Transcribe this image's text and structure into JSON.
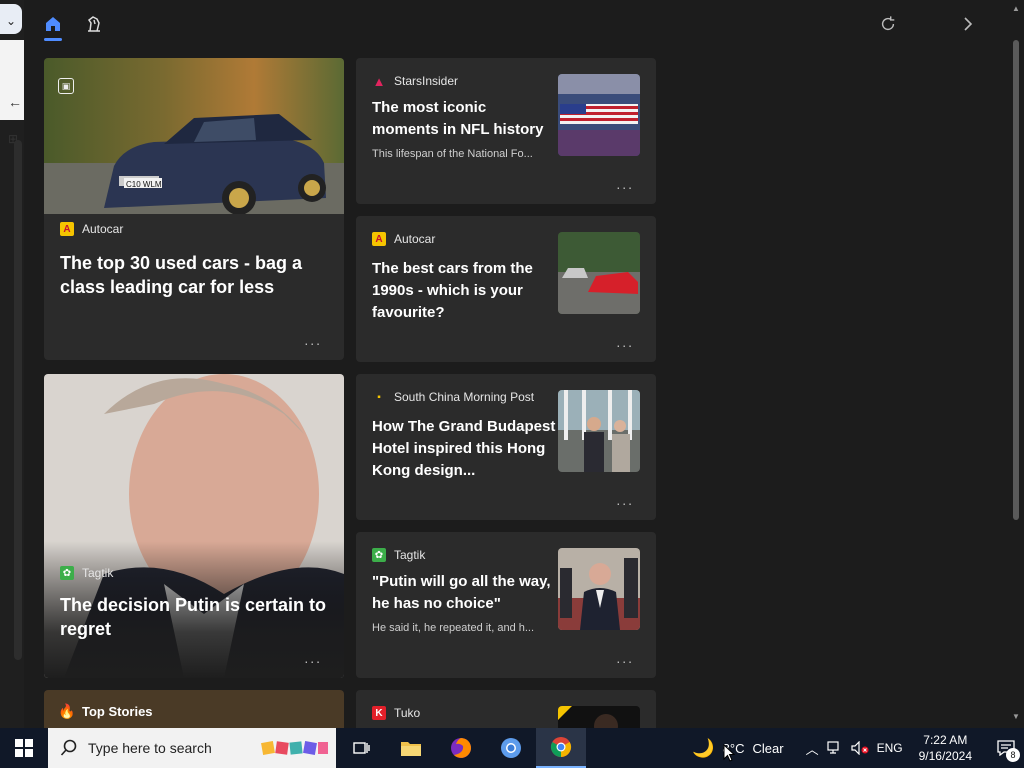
{
  "header": {
    "home_icon": "home-icon",
    "sports_icon": "chess-knight-icon",
    "refresh_icon": "refresh-icon",
    "next_icon": "chevron-right-icon"
  },
  "cards": [
    {
      "id": "c1",
      "source": "Autocar",
      "title": "The top 30 used cars - bag a class leading car for less"
    },
    {
      "id": "c2",
      "source": "StarsInsider",
      "title": "The most iconic moments in NFL history",
      "snippet": "This lifespan of the National Fo..."
    },
    {
      "id": "c3",
      "source": "Autocar",
      "title": "The best cars from the 1990s - which is your favourite?"
    },
    {
      "id": "c4",
      "source": "Tagtik",
      "title": "The decision Putin is certain to regret"
    },
    {
      "id": "c5",
      "source": "South China Morning Post",
      "title": "How The Grand Budapest Hotel inspired this Hong Kong design..."
    },
    {
      "id": "c6",
      "source": "Tagtik",
      "title": "\"Putin will go all the way, he has no choice\"",
      "snippet": "He said it, he repeated it, and h..."
    },
    {
      "id": "c7",
      "source": "Top Stories"
    },
    {
      "id": "c8",
      "source": "Tuko"
    }
  ],
  "more_label": "...",
  "taskbar": {
    "search_placeholder": "Type here to search",
    "weather_temp": "8°C",
    "weather_text": "Clear",
    "language": "ENG",
    "time": "7:22 AM",
    "date": "9/16/2024",
    "notification_count": "8"
  },
  "colors": {
    "panel_bg": "#1c1c1c",
    "card_bg": "#2b2b2b",
    "accent": "#4f8cff",
    "autocar_logo": "#f5c400",
    "starsinsider_logo": "#e0245e",
    "tuko_logo": "#e3202a",
    "tagtik_logo": "#3cae4a"
  }
}
